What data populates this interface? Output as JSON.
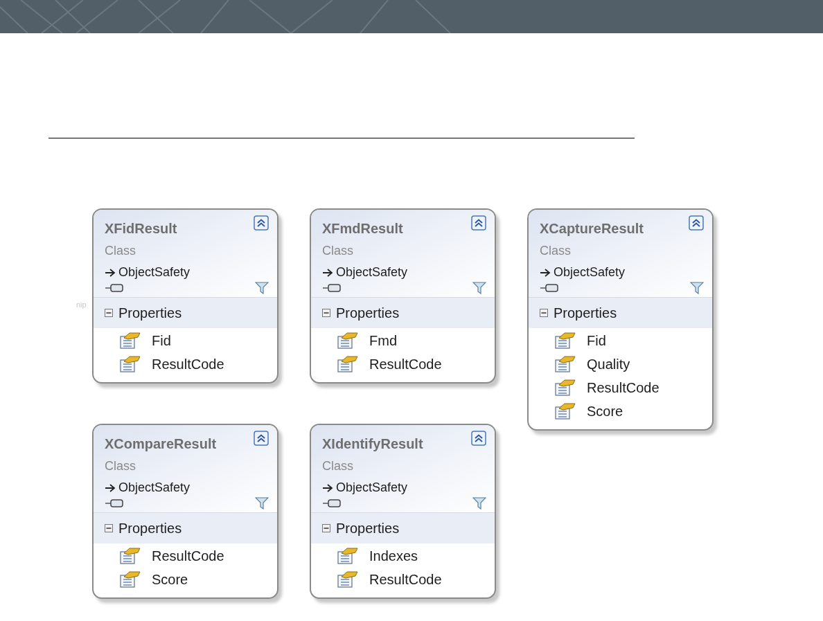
{
  "stray_label": "nip",
  "columns": [
    [
      {
        "name": "XFidResult",
        "type_label": "Class",
        "interface": "ObjectSafety",
        "section": {
          "title": "Properties",
          "expanded": true,
          "items": [
            "Fid",
            "ResultCode"
          ]
        }
      },
      {
        "name": "XCompareResult",
        "type_label": "Class",
        "interface": "ObjectSafety",
        "section": {
          "title": "Properties",
          "expanded": true,
          "items": [
            "ResultCode",
            "Score"
          ]
        }
      }
    ],
    [
      {
        "name": "XFmdResult",
        "type_label": "Class",
        "interface": "ObjectSafety",
        "section": {
          "title": "Properties",
          "expanded": true,
          "items": [
            "Fmd",
            "ResultCode"
          ]
        }
      },
      {
        "name": "XIdentifyResult",
        "type_label": "Class",
        "interface": "ObjectSafety",
        "section": {
          "title": "Properties",
          "expanded": true,
          "items": [
            "Indexes",
            "ResultCode"
          ]
        }
      }
    ],
    [
      {
        "name": "XCaptureResult",
        "type_label": "Class",
        "interface": "ObjectSafety",
        "section": {
          "title": "Properties",
          "expanded": true,
          "items": [
            "Fid",
            "Quality",
            "ResultCode",
            "Score"
          ]
        }
      }
    ]
  ]
}
